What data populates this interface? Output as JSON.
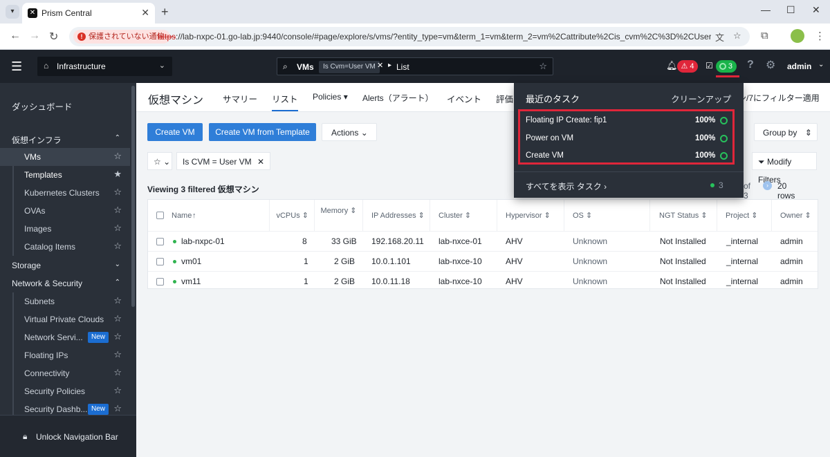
{
  "browser": {
    "tab_title": "Prism Central",
    "security_label": "保護されていない通信",
    "url_scheme": "https",
    "url_rest": "://lab-nxpc-01.go-lab.jp:9440/console/#page/explore/s/vms/?entity_type=vm&term_1=vm&term_2=vm%2Cattribute%2Cis_cvm%2C%3D%2CUser%20..."
  },
  "header": {
    "domain": "Infrastructure",
    "search_entity": "VMs",
    "search_chip": "Is Cvm=User VM",
    "search_view": "List",
    "alert_count": "4",
    "task_count": "3",
    "user": "admin"
  },
  "sidebar": {
    "dashboard": "ダッシュボード",
    "section_infra": "仮想インフラ",
    "infra_items": [
      {
        "label": "VMs"
      },
      {
        "label": "Templates"
      },
      {
        "label": "Kubernetes Clusters"
      },
      {
        "label": "OVAs"
      },
      {
        "label": "Images"
      },
      {
        "label": "Catalog Items"
      }
    ],
    "section_storage": "Storage",
    "section_network": "Network & Security",
    "network_items": [
      {
        "label": "Subnets"
      },
      {
        "label": "Virtual Private Clouds"
      },
      {
        "label": "Network Servi...",
        "badge": "New"
      },
      {
        "label": "Floating IPs"
      },
      {
        "label": "Connectivity"
      },
      {
        "label": "Security Policies"
      },
      {
        "label": "Security Dashb...",
        "badge": "New"
      }
    ],
    "unlock": "Unlock Navigation Bar"
  },
  "main": {
    "title": "仮想マシン",
    "tabs": [
      "サマリー",
      "リスト",
      "Policies",
      "Alerts（アラート）",
      "イベント",
      "評価"
    ],
    "filter_note": "ン/7にフィルター適用",
    "create_vm": "Create VM",
    "create_from_template": "Create VM from Template",
    "actions": "Actions",
    "group_by": "Group by",
    "filter_chip": "Is CVM = User VM",
    "modify_filters": "Modify Filters",
    "viewing": "Viewing 3 filtered 仮想マシン",
    "pager_of": "of 3",
    "rows": "20 rows"
  },
  "table": {
    "columns": [
      "Name",
      "vCPUs",
      "Memory",
      "IP Addresses",
      "Cluster",
      "Hypervisor",
      "OS",
      "NGT Status",
      "Project",
      "Owner"
    ],
    "rows": [
      {
        "name": "lab-nxpc-01",
        "vcpus": "8",
        "memory": "33 GiB",
        "ip": "192.168.20.11",
        "cluster": "lab-nxce-01",
        "hypervisor": "AHV",
        "os": "Unknown",
        "ngt": "Not Installed",
        "project": "_internal",
        "owner": "admin"
      },
      {
        "name": "vm01",
        "vcpus": "1",
        "memory": "2 GiB",
        "ip": "10.0.1.101",
        "cluster": "lab-nxce-10",
        "hypervisor": "AHV",
        "os": "Unknown",
        "ngt": "Not Installed",
        "project": "_internal",
        "owner": "admin"
      },
      {
        "name": "vm11",
        "vcpus": "1",
        "memory": "2 GiB",
        "ip": "10.0.11.18",
        "cluster": "lab-nxce-10",
        "hypervisor": "AHV",
        "os": "Unknown",
        "ngt": "Not Installed",
        "project": "_internal",
        "owner": "admin"
      }
    ]
  },
  "tasks_popup": {
    "title": "最近のタスク",
    "cleanup": "クリーンアップ",
    "tasks": [
      {
        "name": "Floating IP Create: fip1",
        "progress": "100%"
      },
      {
        "name": "Power on VM",
        "progress": "100%"
      },
      {
        "name": "Create VM",
        "progress": "100%"
      }
    ],
    "show_all": "すべてを表示 タスク ›",
    "count": "3"
  },
  "colors": {
    "accent": "#2f7ed8",
    "highlight": "#e0263a",
    "success": "#27c15c"
  }
}
